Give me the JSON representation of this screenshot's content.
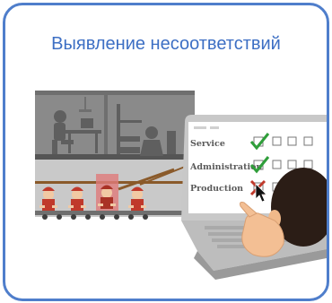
{
  "title": "Выявление несоответствий",
  "accent_color": "#4f7ecb",
  "title_color": "#3d6fc4",
  "checklist": {
    "rows": [
      {
        "label": "Service",
        "mark": "check"
      },
      {
        "label": "Administration",
        "mark": "check"
      },
      {
        "label": "Production",
        "mark": "cross"
      }
    ]
  },
  "icons": {
    "cursor": "mouse-pointer-icon",
    "check": "check-mark-icon",
    "cross": "cross-mark-icon"
  }
}
